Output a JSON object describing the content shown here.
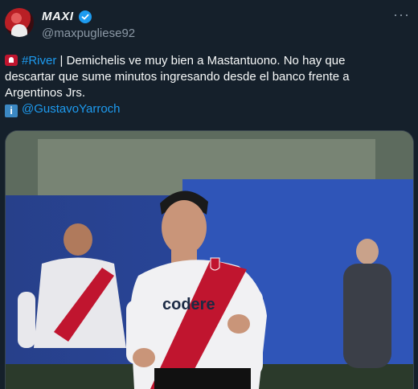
{
  "author": {
    "display_name": "MAXI",
    "handle": "@maxpugliese92",
    "verified": true,
    "avatar_icon": "avatar-photo"
  },
  "menu": {
    "more_label": "···"
  },
  "tweet": {
    "hashtag": "#River",
    "line1_rest": " | Demichelis ve muy bien a Mastantuono. No hay que",
    "line2": "descartar que sume minutos ingresando desde el banco frente a",
    "line3": "Argentinos Jrs.",
    "mention": "@GustavoYarroch",
    "siren_icon": "police-light-icon",
    "info_icon": "information-icon",
    "info_label": "i"
  },
  "media": {
    "alt": "Photo of a River Plate player in a white jersey with a red sash and 'codere' sponsor",
    "shirt_sponsor": "codere"
  },
  "colors": {
    "background": "#15202b",
    "link": "#1d9bf0",
    "secondary_text": "#8b98a5",
    "primary_text": "#f7f9f9"
  }
}
